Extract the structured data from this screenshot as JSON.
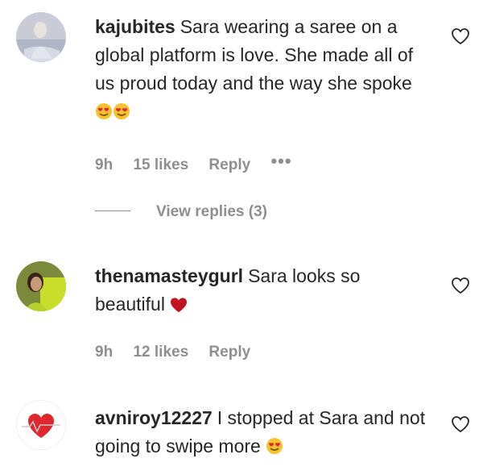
{
  "comments": [
    {
      "username": "kajubites",
      "text": "Sara wearing a saree on a global platform is love. She made all of us proud today and the way she spoke",
      "emoji": "heart-eyes-emoji heart-eyes-emoji",
      "time": "9h",
      "likes": "15 likes",
      "reply": "Reply",
      "more": "•••",
      "view_replies": "View replies (3)"
    },
    {
      "username": "thenamasteygurl",
      "text": "Sara looks so beautiful",
      "emoji": "red-heart-emoji",
      "time": "9h",
      "likes": "12 likes",
      "reply": "Reply"
    },
    {
      "username": "avniroy12227",
      "text": "I stopped at Sara and not going to swipe more",
      "emoji": "heart-eyes-emoji"
    }
  ],
  "colors": {
    "text": "#262626",
    "muted": "#8e8e8e",
    "heart_red": "#c1121f",
    "emoji_yellow": "#f7c22a"
  }
}
